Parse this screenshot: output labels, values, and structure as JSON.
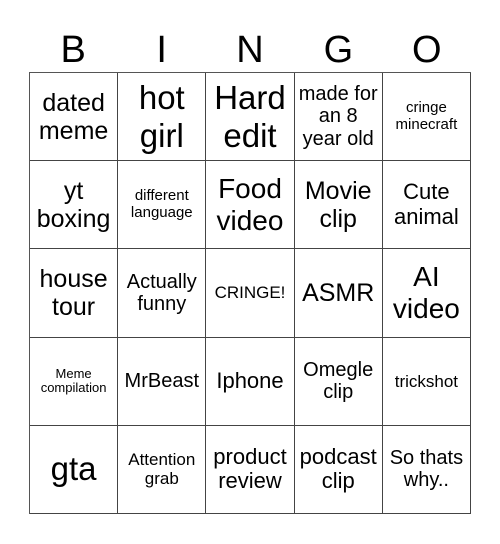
{
  "header": {
    "letters": [
      "B",
      "I",
      "N",
      "G",
      "O"
    ]
  },
  "cells": [
    [
      "dated meme",
      "hot girl",
      "Hard edit",
      "made for an 8 year old",
      "cringe minecraft"
    ],
    [
      "yt boxing",
      "different language",
      "Food video",
      "Movie clip",
      "Cute animal"
    ],
    [
      "house tour",
      "Actually funny",
      "CRINGE!",
      "ASMR",
      "AI video"
    ],
    [
      "Meme compilation",
      "MrBeast",
      "Iphone",
      "Omegle clip",
      "trickshot"
    ],
    [
      "gta",
      "Attention grab",
      "product review",
      "podcast clip",
      "So thats why.."
    ]
  ]
}
